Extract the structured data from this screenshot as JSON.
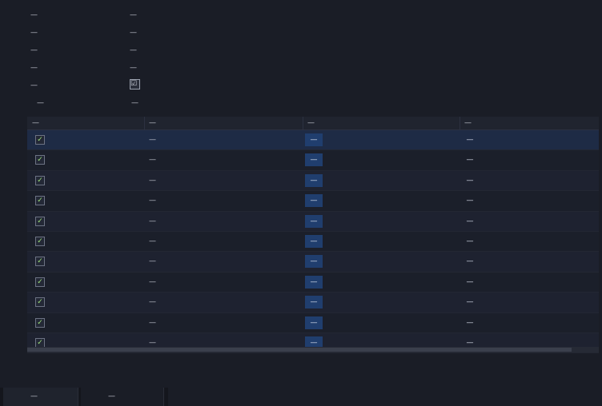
{
  "properties": [
    {
      "label": "—",
      "value": "—"
    },
    {
      "label": "—",
      "value": "—"
    },
    {
      "label": "—",
      "value": "—"
    },
    {
      "label": "—",
      "value": "—"
    },
    {
      "label": "—",
      "checked": true,
      "value": "☑"
    }
  ],
  "transform": {
    "label": "—",
    "value": "—"
  },
  "grid": {
    "headers": [
      "—",
      "—",
      "—",
      "—"
    ],
    "rows": [
      {
        "check": "✓",
        "name": "—",
        "b": "—",
        "c": "—"
      },
      {
        "check": "✓",
        "name": "—",
        "b": "—",
        "c": "—"
      },
      {
        "check": "✓",
        "name": "—",
        "b": "—",
        "c": "—"
      },
      {
        "check": "✓",
        "name": "—",
        "b": "—",
        "c": "—"
      },
      {
        "check": "✓",
        "name": "—",
        "b": "—",
        "c": "—"
      },
      {
        "check": "✓",
        "name": "—",
        "b": "—",
        "c": "—"
      },
      {
        "check": "✓",
        "name": "—",
        "b": "—",
        "c": "—"
      },
      {
        "check": "✓",
        "name": "—",
        "b": "—",
        "c": "—"
      },
      {
        "check": "✓",
        "name": "—",
        "b": "—",
        "c": "—"
      },
      {
        "check": "✓",
        "name": "—",
        "b": "—",
        "c": "—"
      },
      {
        "check": "✓",
        "name": "—",
        "b": "—",
        "c": "—"
      }
    ]
  },
  "bottom_tabs": [
    "—",
    "—"
  ]
}
